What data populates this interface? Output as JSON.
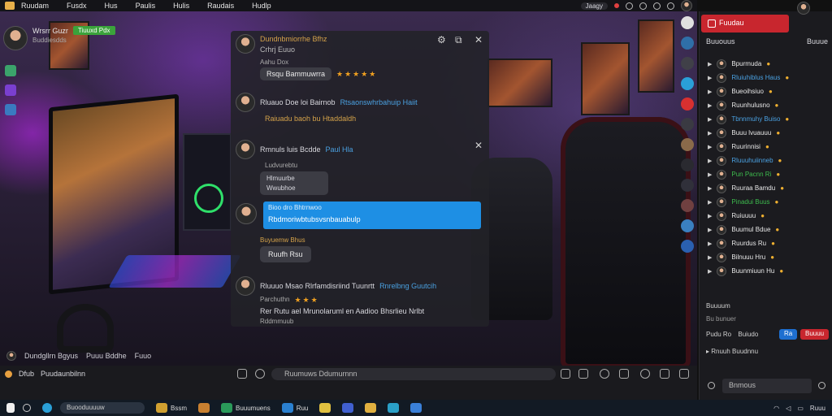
{
  "menubar": {
    "items": [
      "Ruudam",
      "Fusdx",
      "Hus",
      "Paulis",
      "Hulis",
      "Raudais",
      "Hudlp"
    ],
    "right_pill": "Jaagy",
    "icons": [
      "bell-icon",
      "search-icon",
      "settings-icon",
      "minimize-icon",
      "maximize-icon",
      "close-icon"
    ]
  },
  "streamer": {
    "name": "Wrsrr Guzr",
    "live_badge": "Tiuuxd Pdx",
    "subtitle": "Buddiesdds"
  },
  "stream_info": {
    "viewer": "Dundgllrn Bgyus",
    "time": "Puuu Bddhe",
    "count": "Fuuo"
  },
  "chat": {
    "messages": [
      {
        "user": "Dundnbmiorrhe Bfhz",
        "user_color": "#d4a24a",
        "sub": "Crhrj Euuo",
        "bubble": "Rsqu Bammuwrra",
        "sub2": "Aahu Dox",
        "stars": "★★★★★"
      },
      {
        "user": "Rluauo Doe loi Bairnob",
        "user_color": "#e6e6e6",
        "rest": "Rtsaonswhrbahuip Haiit",
        "rest_color": "#4aa0e0",
        "line2": "Raiuadu baoh bu Htaddaldh"
      },
      {
        "user": "Rmnuls luis Bcdde",
        "rest": "Paul Hla",
        "sub": "Ludvurebtu",
        "bubble_lines": [
          "Hlmuurbe",
          "Wwubhoe"
        ]
      },
      {
        "head": "Bioo dro Bhtrnwoo",
        "highlight": "Rbdmoriwbtubsvsnbauabulp"
      },
      {
        "sub": "Buyuemw Bhus",
        "bubble": "Ruufh Rsu"
      },
      {
        "user": "Rluuuo Msao Rlrfamdisriind Tuunrtt",
        "rest": "Rnrelbng Guutcih",
        "rest_color": "#4aa0e0",
        "sub": "Parchuthn",
        "stars": "★★★",
        "line2": "Rer Rutu ael Mrunolaruml en Aadioo Bhsrlieu Nrlbt",
        "line3": "Rddmmuub"
      }
    ]
  },
  "playerbar": {
    "left": [
      "Dfub",
      "Puudaunbilnn"
    ],
    "input_placeholder": "Ruumuws Ddumurnnn"
  },
  "panel": {
    "active_tab": "Fuudau",
    "subtabs": [
      "Buuouus",
      "Buuue"
    ],
    "users": [
      {
        "name": "Bpurmuda",
        "color": "#e6e6e6"
      },
      {
        "name": "Rluiuhiblus Haus",
        "color": "#4aa0e0"
      },
      {
        "name": "Bueoihsiuo",
        "color": "#e6e6e6"
      },
      {
        "name": "Ruunhulusno",
        "color": "#e6e6e6"
      },
      {
        "name": "Tbnnmuhy Buiso",
        "color": "#4aa0e0"
      },
      {
        "name": "Buuu lvuauuu",
        "color": "#e6e6e6"
      },
      {
        "name": "Ruurinnisi",
        "color": "#e6e6e6"
      },
      {
        "name": "Rluuuhuiinneb",
        "color": "#4aa0e0"
      },
      {
        "name": "Pun Pacnn Ri",
        "color": "#3dbb4d"
      },
      {
        "name": "Ruuraa Bamdu",
        "color": "#e6e6e6"
      },
      {
        "name": "Pinadui Buus",
        "color": "#3dbb4d"
      },
      {
        "name": "Ruiuuuu",
        "color": "#e6e6e6"
      },
      {
        "name": "Buumul Bdue",
        "color": "#e6e6e6"
      },
      {
        "name": "Ruurdus Ru",
        "color": "#e6e6e6"
      },
      {
        "name": "Bilnuuu Hru",
        "color": "#e6e6e6"
      },
      {
        "name": "Buunmiuun Hu",
        "color": "#e6e6e6"
      }
    ],
    "section1": "Buuuum",
    "section2": "Bu bunuer",
    "section3_label": "Pudu Ro",
    "section3_name": "Buiudo",
    "btn_blue": "Ra",
    "btn_red": "Buuuu",
    "chat_user": "Rnuuh Buudnnu",
    "chat_placeholder": "Bnmous"
  },
  "taskbar": {
    "search_placeholder": "Buooduuuuw",
    "app1": "Bssm",
    "app2": "Buuumuens",
    "app3": "Ruu",
    "tray_text": "Ruuu"
  }
}
